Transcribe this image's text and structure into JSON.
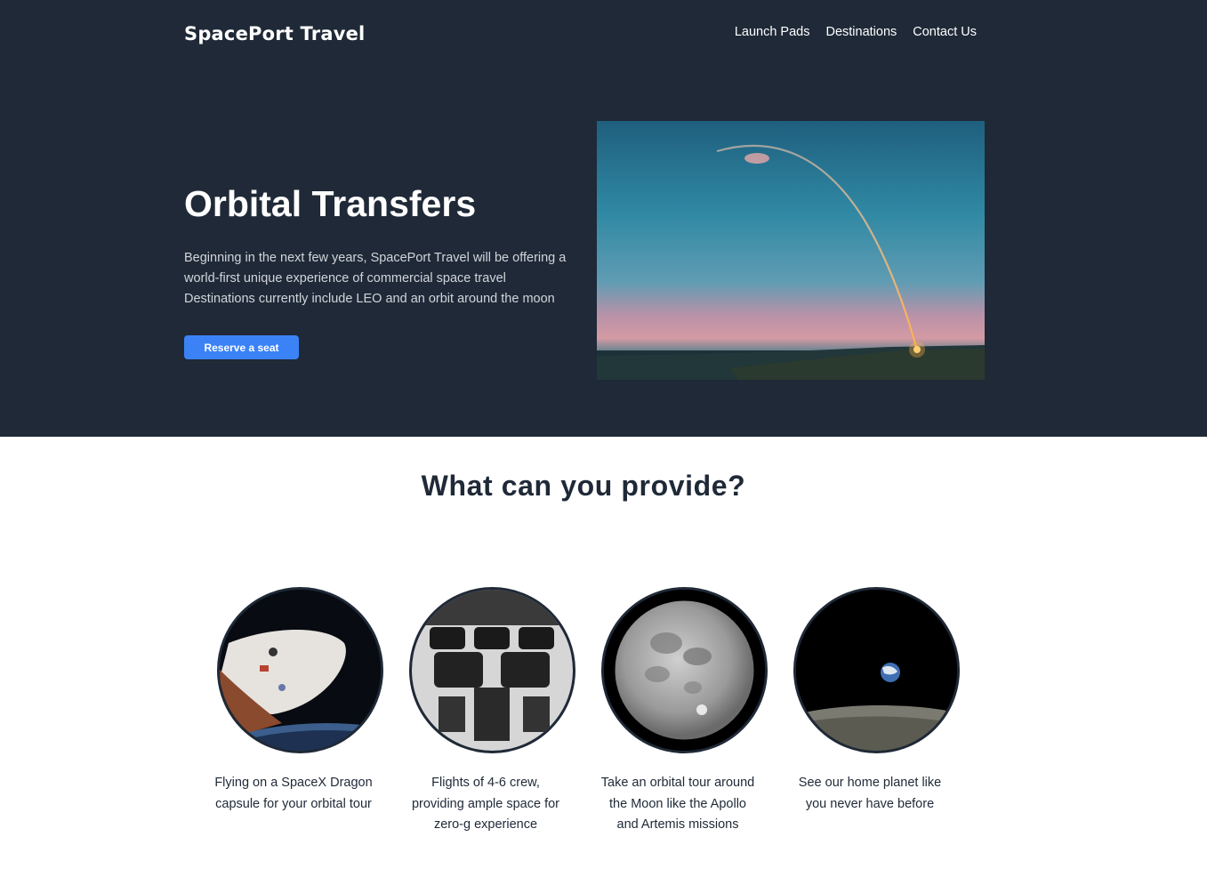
{
  "header": {
    "brand": "SpacePort Travel",
    "nav": [
      "Launch Pads",
      "Destinations",
      "Contact Us"
    ]
  },
  "hero": {
    "title": "Orbital Transfers",
    "text_lines": [
      "Beginning in the next few years, SpacePort Travel will be offering a",
      "world-first unique experience of commercial space travel",
      "Destinations currently include LEO and an orbit around the moon"
    ],
    "cta_label": "Reserve a seat"
  },
  "features": {
    "title": "What can you provide?",
    "items": [
      {
        "icon": "dragon-capsule-image",
        "caption_lines": [
          "Flying on a SpaceX Dragon",
          "capsule for your orbital tour"
        ]
      },
      {
        "icon": "capsule-interior-image",
        "caption_lines": [
          "Flights of 4-6 crew,",
          "providing ample space for",
          "zero-g experience"
        ]
      },
      {
        "icon": "moon-image",
        "caption_lines": [
          "Take an orbital tour around",
          "the Moon like the Apollo",
          "and Artemis missions"
        ]
      },
      {
        "icon": "earthrise-image",
        "caption_lines": [
          "See our home planet like",
          "you never have before"
        ]
      }
    ]
  },
  "colors": {
    "header_bg": "#1f2937",
    "accent": "#3b82f6",
    "text_dark": "#1f2937",
    "text_muted": "#d1d5db"
  }
}
